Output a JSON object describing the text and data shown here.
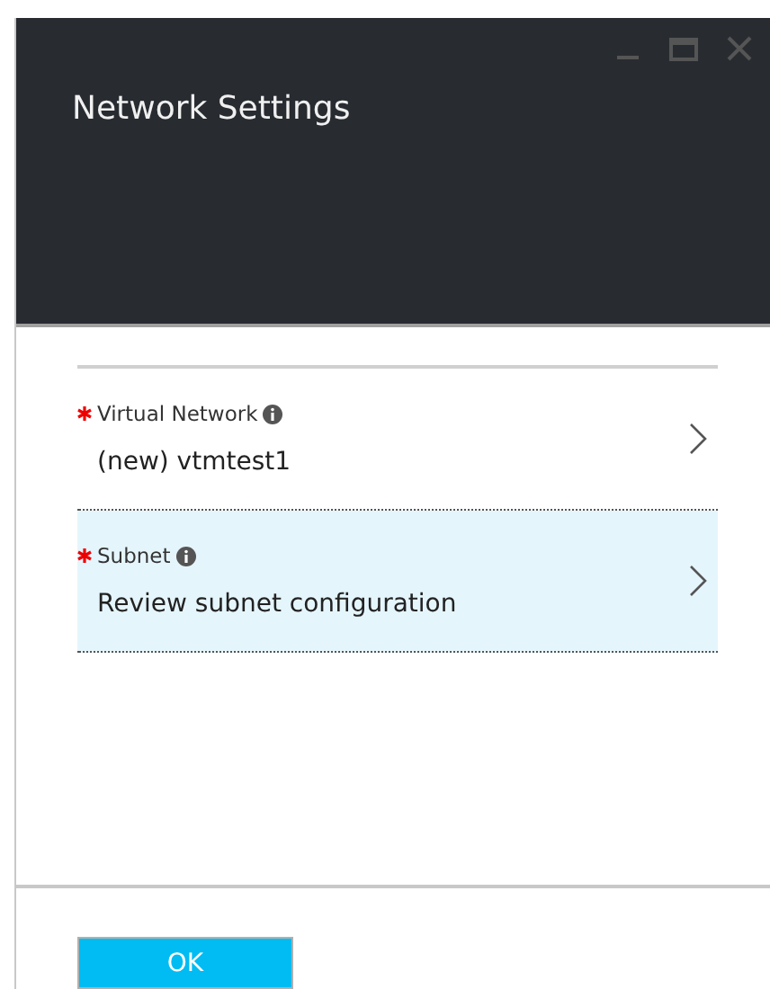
{
  "window": {
    "title": "Network Settings"
  },
  "fields": [
    {
      "label": "Virtual Network",
      "required": true,
      "value": "(new) vtmtest1",
      "selected": false
    },
    {
      "label": "Subnet",
      "required": true,
      "value": "Review subnet configuration",
      "selected": true
    }
  ],
  "buttons": [
    "OK"
  ]
}
